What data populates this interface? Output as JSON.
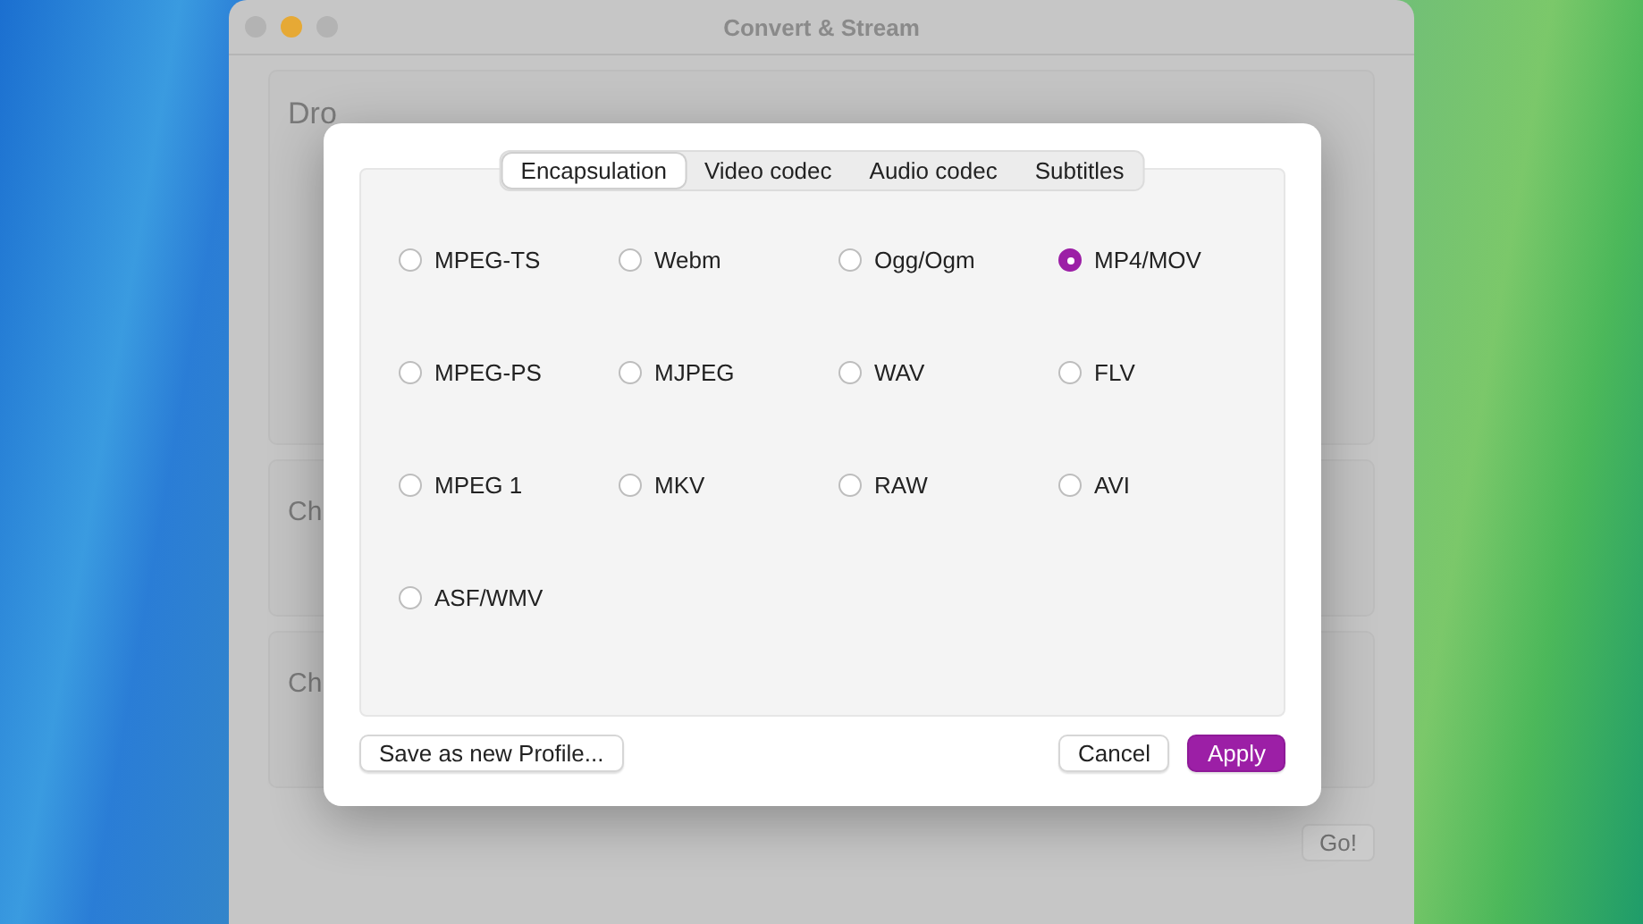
{
  "window": {
    "title": "Convert & Stream"
  },
  "background_sections": [
    {
      "label": "Dro"
    },
    {
      "label": "Ch"
    },
    {
      "label": "Ch"
    }
  ],
  "go_button": {
    "label": "Go!"
  },
  "sheet": {
    "tabs": [
      {
        "label": "Encapsulation",
        "selected": true
      },
      {
        "label": "Video codec",
        "selected": false
      },
      {
        "label": "Audio codec",
        "selected": false
      },
      {
        "label": "Subtitles",
        "selected": false
      }
    ],
    "formats": [
      {
        "label": "MPEG-TS",
        "selected": false
      },
      {
        "label": "Webm",
        "selected": false
      },
      {
        "label": "Ogg/Ogm",
        "selected": false
      },
      {
        "label": "MP4/MOV",
        "selected": true
      },
      {
        "label": "MPEG-PS",
        "selected": false
      },
      {
        "label": "MJPEG",
        "selected": false
      },
      {
        "label": "WAV",
        "selected": false
      },
      {
        "label": "FLV",
        "selected": false
      },
      {
        "label": "MPEG 1",
        "selected": false
      },
      {
        "label": "MKV",
        "selected": false
      },
      {
        "label": "RAW",
        "selected": false
      },
      {
        "label": "AVI",
        "selected": false
      },
      {
        "label": "ASF/WMV",
        "selected": false
      }
    ],
    "buttons": [
      {
        "label": "Save as new Profile...",
        "kind": "secondary"
      },
      {
        "label": "Cancel",
        "kind": "secondary"
      },
      {
        "label": "Apply",
        "kind": "primary"
      }
    ]
  }
}
